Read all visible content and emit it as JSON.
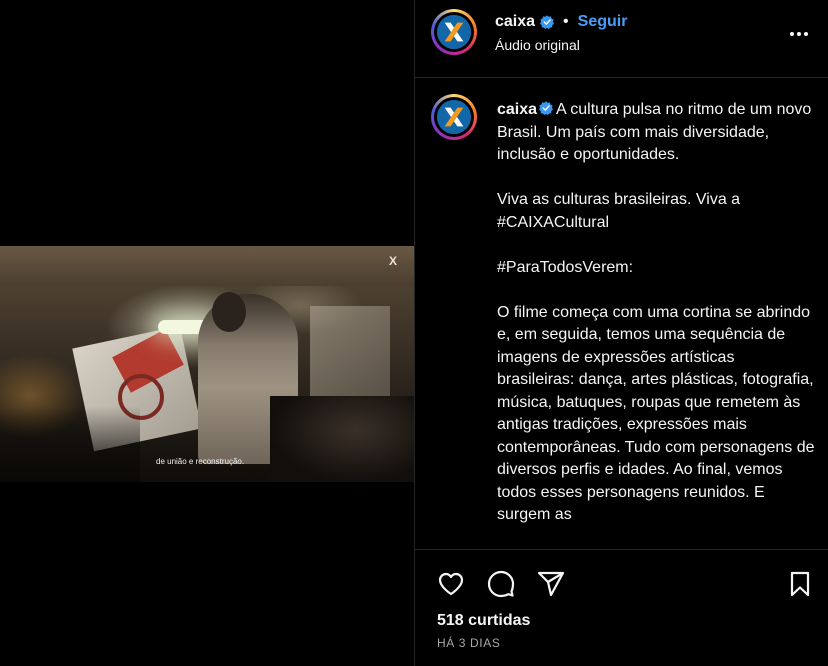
{
  "post": {
    "author": "caixa",
    "follow_label": "Seguir",
    "separator": "•",
    "audio_label": "Áudio original",
    "more_icon": "more-horizontal-icon",
    "verified_icon": "verified-badge-icon",
    "accent_color": "#4a9df8",
    "video_subtitle": "de união e reconstrução.",
    "video_watermark": "X",
    "caption_text": "A cultura pulsa no ritmo de um novo Brasil. Um país com mais diversidade, inclusão e oportunidades.\n\nViva as culturas brasileiras. Viva a #CAIXACultural\n\n#ParaTodosVerem:\n\nO filme começa com uma cortina se abrindo e, em seguida, temos uma sequência de imagens de expressões artísticas brasileiras: dança, artes plásticas, fotografia, música, batuques, roupas que remetem às antigas tradições, expressões mais contemporâneas. Tudo com personagens de diversos perfis e idades. Ao final, vemos todos esses personagens reunidos. E surgem as",
    "likes": "518 curtidas",
    "timestamp": "HÁ 3 DIAS",
    "actions": {
      "like_icon": "heart-icon",
      "comment_icon": "comment-icon",
      "share_icon": "paper-plane-icon",
      "save_icon": "bookmark-icon"
    }
  }
}
